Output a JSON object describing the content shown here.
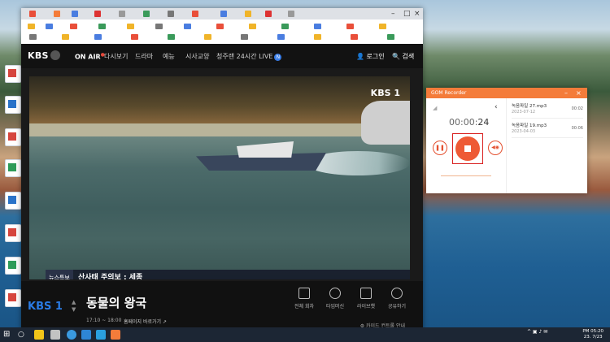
{
  "kbs": {
    "logo": "KBS",
    "nav": [
      "ON AIR",
      "다시보기",
      "드라마",
      "예능",
      "시사교양",
      "청주랜 24시간 LIVE"
    ],
    "nav_badge": "N",
    "login": "로그인",
    "search": "검색"
  },
  "video": {
    "watermark": "KBS 1",
    "caption_label": "뉴스특보",
    "caption_text": "산사태 주의보 : 세종"
  },
  "program": {
    "channel_logo": "KBS 1",
    "title": "동물의 왕국",
    "time": "17:10 ~ 18:00",
    "homepage_link": "홈페이지 바로가기",
    "actions": [
      "전체 회차",
      "타임머신",
      "라이브챗",
      "공유하기"
    ],
    "guide": "카이드 컨트롤 안내"
  },
  "gom": {
    "title": "GOM Recorder",
    "timer_prefix": "00:00:",
    "timer_seconds": "24",
    "files": [
      {
        "name": "녹음파일 27.mp3",
        "date": "2023-07-12",
        "duration": "00:02"
      },
      {
        "name": "녹음파일 19.mp3",
        "date": "2023-04-03",
        "duration": "00:06"
      }
    ]
  },
  "taskbar": {
    "clock_time": "PM 05:20",
    "clock_date": "23. 7/23"
  }
}
